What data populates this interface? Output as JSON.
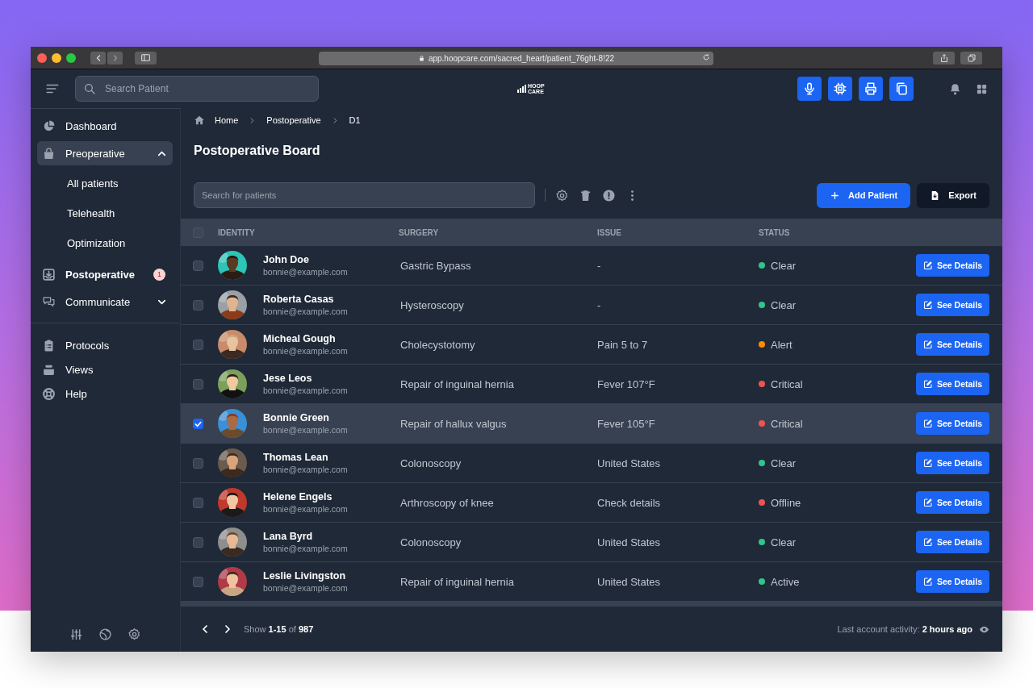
{
  "browser": {
    "url": "app.hoopcare.com/sacred_heart/patient_76ght-8!22"
  },
  "header": {
    "search": {
      "placeholder": "Search Patient"
    },
    "logo": [
      "HOOP",
      "CARE"
    ]
  },
  "sidebar": {
    "items": [
      {
        "label": "Dashboard",
        "selected": false
      },
      {
        "label": "Preoperative",
        "selected": false,
        "expanded": true,
        "children": [
          {
            "label": "All patients"
          },
          {
            "label": "Telehealth"
          },
          {
            "label": "Optimization"
          }
        ]
      },
      {
        "label": "Postoperative",
        "selected": true,
        "badge": "1"
      },
      {
        "label": "Communicate",
        "selected": false,
        "expanded": false
      }
    ],
    "secondary_items": [
      {
        "label": "Protocols"
      },
      {
        "label": "Views"
      },
      {
        "label": "Help"
      }
    ]
  },
  "breadcrumb": [
    "Home",
    "Postoperative",
    "D1"
  ],
  "page_title": "Postoperative Board",
  "toolbar": {
    "search": {
      "placeholder": "Search for patients"
    },
    "buttons": [
      {
        "label": "Add Patient",
        "kind": "primary"
      },
      {
        "label": "Export",
        "kind": "dark"
      }
    ]
  },
  "table": {
    "select_all": {
      "checked": false
    },
    "columns": [
      "IDENTITY",
      "SURGERY",
      "ISSUE",
      "STATUS"
    ],
    "rows": [
      {
        "name": "John Doe",
        "email": "bonnie@example.com",
        "surgery": "Gastric Bypass",
        "issue": "-",
        "status": "Clear",
        "color": "#31c48d",
        "selected": false,
        "action": "See Details"
      },
      {
        "name": "Roberta Casas",
        "email": "bonnie@example.com",
        "surgery": "Hysteroscopy",
        "issue": "-",
        "status": "Clear",
        "color": "#31c48d",
        "selected": false,
        "action": "See Details"
      },
      {
        "name": "Micheal Gough",
        "email": "bonnie@example.com",
        "surgery": "Cholecystotomy",
        "issue": "Pain 5 to 7",
        "status": "Alert",
        "color": "#ff8a00",
        "selected": false,
        "action": "See Details"
      },
      {
        "name": "Jese Leos",
        "email": "bonnie@example.com",
        "surgery": "Repair of inguinal hernia",
        "issue": "Fever 107°F",
        "status": "Critical",
        "color": "#f05252",
        "selected": false,
        "action": "See Details"
      },
      {
        "name": "Bonnie Green",
        "email": "bonnie@example.com",
        "surgery": "Repair of hallux valgus",
        "issue": "Fever 105°F",
        "status": "Critical",
        "color": "#f05252",
        "selected": true,
        "action": "See Details"
      },
      {
        "name": "Thomas Lean",
        "email": "bonnie@example.com",
        "surgery": "Colonoscopy",
        "issue": "United States",
        "status": "Clear",
        "color": "#31c48d",
        "selected": false,
        "action": "See Details"
      },
      {
        "name": "Helene Engels",
        "email": "bonnie@example.com",
        "surgery": "Arthroscopy of knee",
        "issue": "Check details",
        "status": "Offline",
        "color": "#f05252",
        "selected": false,
        "action": "See Details"
      },
      {
        "name": "Lana Byrd",
        "email": "bonnie@example.com",
        "surgery": "Colonoscopy",
        "issue": "United States",
        "status": "Clear",
        "color": "#31c48d",
        "selected": false,
        "action": "See Details"
      },
      {
        "name": "Leslie Livingston",
        "email": "bonnie@example.com",
        "surgery": "Repair of inguinal hernia",
        "issue": "United States",
        "status": "Active",
        "color": "#31c48d",
        "selected": false,
        "action": "See Details"
      }
    ]
  },
  "footer": {
    "range": "Show **1-15** of **987**",
    "activity": "Last account activity: **2 hours ago**"
  }
}
